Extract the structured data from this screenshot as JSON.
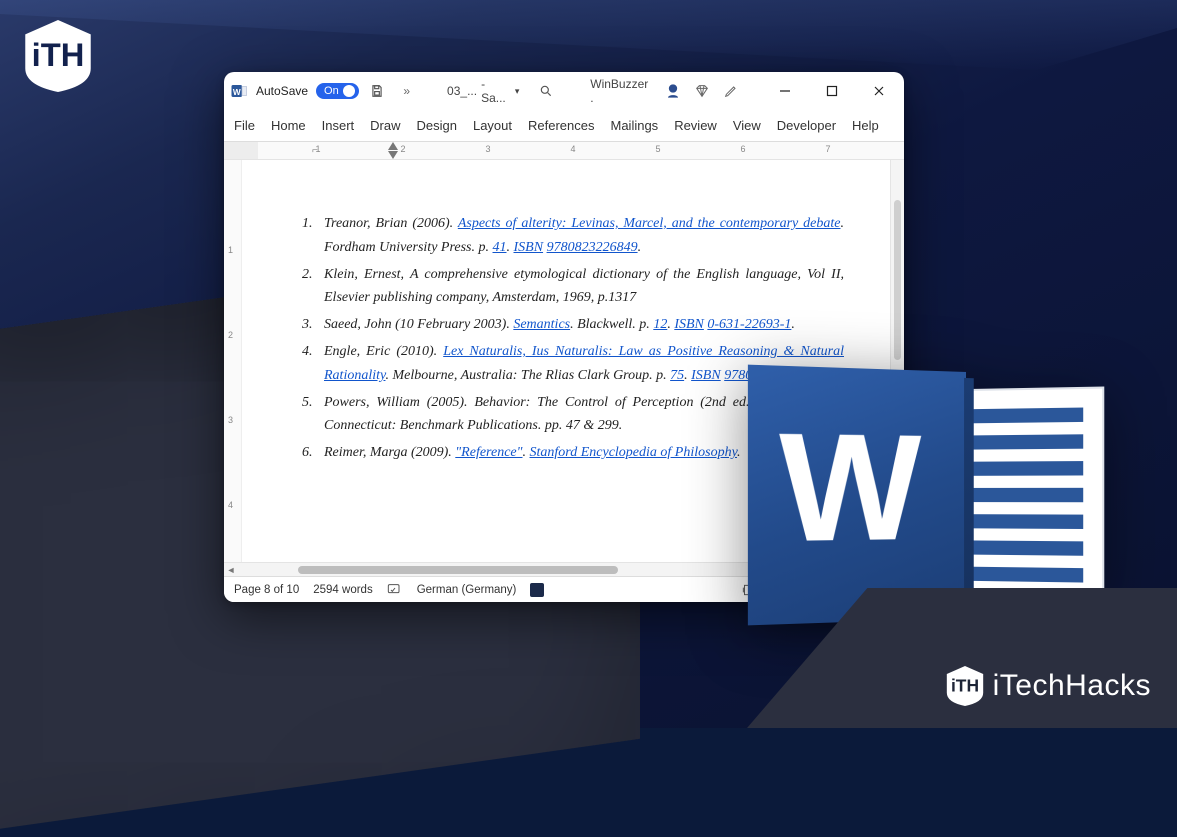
{
  "brand": {
    "bottom_text": "iTechHacks"
  },
  "titlebar": {
    "autosave_label": "AutoSave",
    "autosave_state": "On",
    "doc_name_left": "03_...",
    "doc_name_right": "- Sa...",
    "account": "WinBuzzer ."
  },
  "ribbon": {
    "tabs": [
      "File",
      "Home",
      "Insert",
      "Draw",
      "Design",
      "Layout",
      "References",
      "Mailings",
      "Review",
      "View",
      "Developer",
      "Help"
    ]
  },
  "ruler": {
    "numbers": [
      "1",
      "2",
      "3",
      "4",
      "5",
      "6",
      "7"
    ]
  },
  "vruler": {
    "numbers": [
      "1",
      "2",
      "3",
      "4"
    ]
  },
  "references": [
    {
      "num": "1.",
      "prefix": "Treanor, Brian (2006). ",
      "link1": "Aspects of alterity: Levinas, Marcel, and the contemporary debate",
      "mid1": ". Fordham University Press. p. ",
      "page": "41",
      "mid2": ". ",
      "isbn_label": "ISBN",
      "sp": " ",
      "isbn_val": "9780823226849",
      "tail": "."
    },
    {
      "num": "2.",
      "plain": "Klein, Ernest, ",
      "ital": "A comprehensive etymological dictionary of the English language",
      "tail": ", Vol II, Elsevier publishing company, Amsterdam, 1969, p.1317"
    },
    {
      "num": "3.",
      "prefix": "Saeed, John (10 February 2003). ",
      "link1": "Semantics",
      "mid1": ". Blackwell. p. ",
      "page": "12",
      "mid2": ". ",
      "isbn_label": "ISBN",
      "sp": " ",
      "isbn_val": "0-631-22693-1",
      "tail": "."
    },
    {
      "num": "4.",
      "prefix": "Engle, Eric (2010). ",
      "link1": "Lex Naturalis, Ius Naturalis: Law as Positive Reasoning & Natural Rationality",
      "mid1": ". Melbourne, Australia: The Rlias Clark Group. p. ",
      "page": "75",
      "mid2": ". ",
      "isbn_label": "ISBN",
      "sp": " ",
      "isbn_val": "9780980731842",
      "tail": "."
    },
    {
      "num": "5.",
      "plain": "Powers, William (2005). Behavior: The Control of Perception (2nd ed.). New Canaan, Connecticut: Benchmark Publications. pp. 47 & 299."
    },
    {
      "num": "6.",
      "prefix": "Reimer, Marga (2009). ",
      "link1": "\"Reference\"",
      "mid1": ". ",
      "link2": "Stanford Encyclopedia of Philosophy",
      "tail": "."
    }
  ],
  "statusbar": {
    "page": "Page 8 of 10",
    "words": "2594 words",
    "language": "German (Germany)",
    "focus": "Focus"
  }
}
